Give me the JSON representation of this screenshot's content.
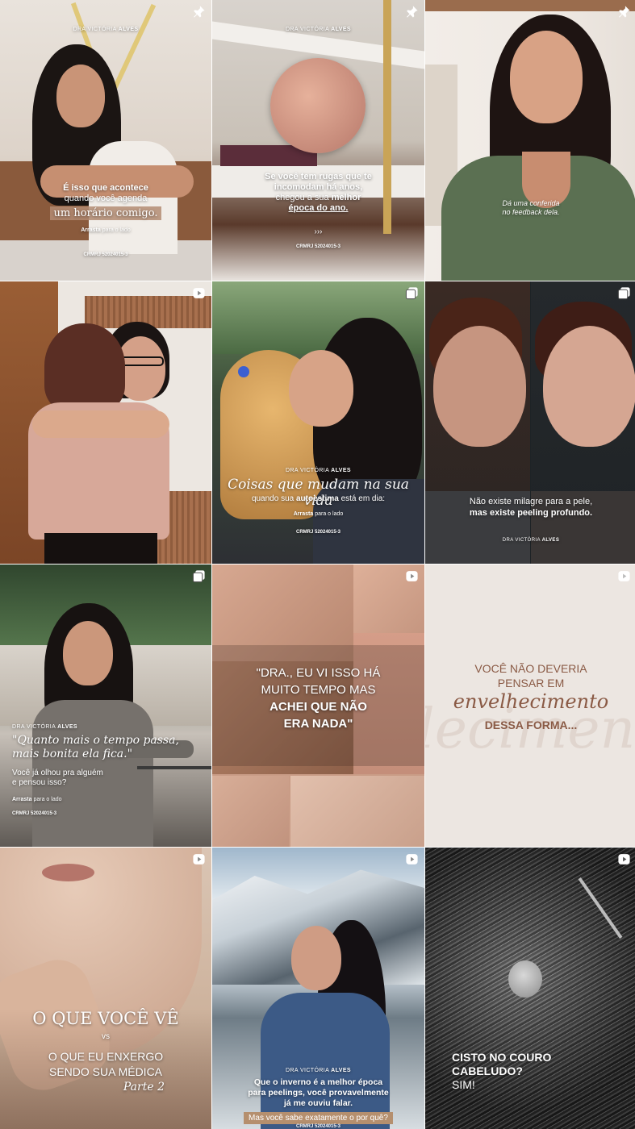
{
  "tiles": [
    {
      "kind": "pinned",
      "brand_prefix": "DRA VICTÓRIA",
      "brand_name": "ALVES",
      "line1_bold": "É isso que acontece",
      "line2": "quando você agenda",
      "highlight": "um horário comigo.",
      "swipe_bold": "Arrasta",
      "swipe_rest": "para o lado",
      "crm": "CRMRJ 52024015-3"
    },
    {
      "kind": "pinned",
      "brand_prefix": "DRA VICTÓRIA",
      "brand_name": "ALVES",
      "line1": "Se você tem rugas que te",
      "line2": "incomodam há anos,",
      "line3_start": "chegou a sua",
      "line3_bold": "melhor",
      "line4": "época do ano.",
      "arrows": "›››",
      "crm": "CRMRJ 52024015-3"
    },
    {
      "kind": "pinned",
      "caption_line1": "Dá uma conferida",
      "caption_line2": "no feedback dela."
    },
    {
      "kind": "reel"
    },
    {
      "kind": "carousel",
      "brand_prefix": "DRA VICTÓRIA",
      "brand_name": "ALVES",
      "title": "Coisas que mudam na sua vida",
      "sub_start": "quando sua",
      "sub_bold": "autoestima",
      "sub_end": "está em dia:",
      "swipe_bold": "Arrasta",
      "swipe_rest": "para o lado",
      "crm": "CRMRJ 52024015-3"
    },
    {
      "kind": "carousel",
      "line1": "Não existe milagre para a pele,",
      "line2": "mas existe peeling profundo.",
      "brand_prefix": "DRA VICTÓRIA",
      "brand_name": "ALVES"
    },
    {
      "kind": "carousel",
      "brand_prefix": "DRA VICTÓRIA",
      "brand_name": "ALVES",
      "quote_line1": "\"Quanto mais o tempo passa,",
      "quote_line2": "mais bonita ela fica.\"",
      "q_line1": "Você já olhou pra alguém",
      "q_line2": "e pensou isso?",
      "swipe_bold": "Arrasta",
      "swipe_rest": "para o lado",
      "crm": "CRMRJ 52024015-3"
    },
    {
      "kind": "reel",
      "line1": "\"DRA., EU VI ISSO HÁ",
      "line2": "MUITO TEMPO MAS",
      "line3": "ACHEI QUE NÃO",
      "line4": "ERA NADA\""
    },
    {
      "kind": "reel",
      "line1": "VOCÊ NÃO DEVERIA",
      "line2": "PENSAR EM",
      "script": "envelhecimento",
      "line3": "DESSA FORMA...",
      "watermark": "lecimen"
    },
    {
      "kind": "reel",
      "title": "O QUE VOCÊ VÊ",
      "vs": "vs",
      "line2": "O QUE EU ENXERGO",
      "line3": "SENDO SUA MÉDICA",
      "part": "Parte 2"
    },
    {
      "kind": "reel",
      "brand_prefix": "DRA VICTÓRIA",
      "brand_name": "ALVES",
      "line1": "Que o inverno é a melhor época",
      "line2": "para peelings, você provavelmente",
      "line3": "já me ouviu falar.",
      "pill": "Mas você sabe exatamente o por quê?",
      "crm": "CRMRJ 52024015-3"
    },
    {
      "kind": "reel",
      "line1": "CISTO NO COURO",
      "line2": "CABELUDO?",
      "line3": "SIM!"
    }
  ],
  "icons": {
    "pinned": "pin-icon",
    "carousel": "carousel-icon",
    "reel": "reel-icon"
  }
}
